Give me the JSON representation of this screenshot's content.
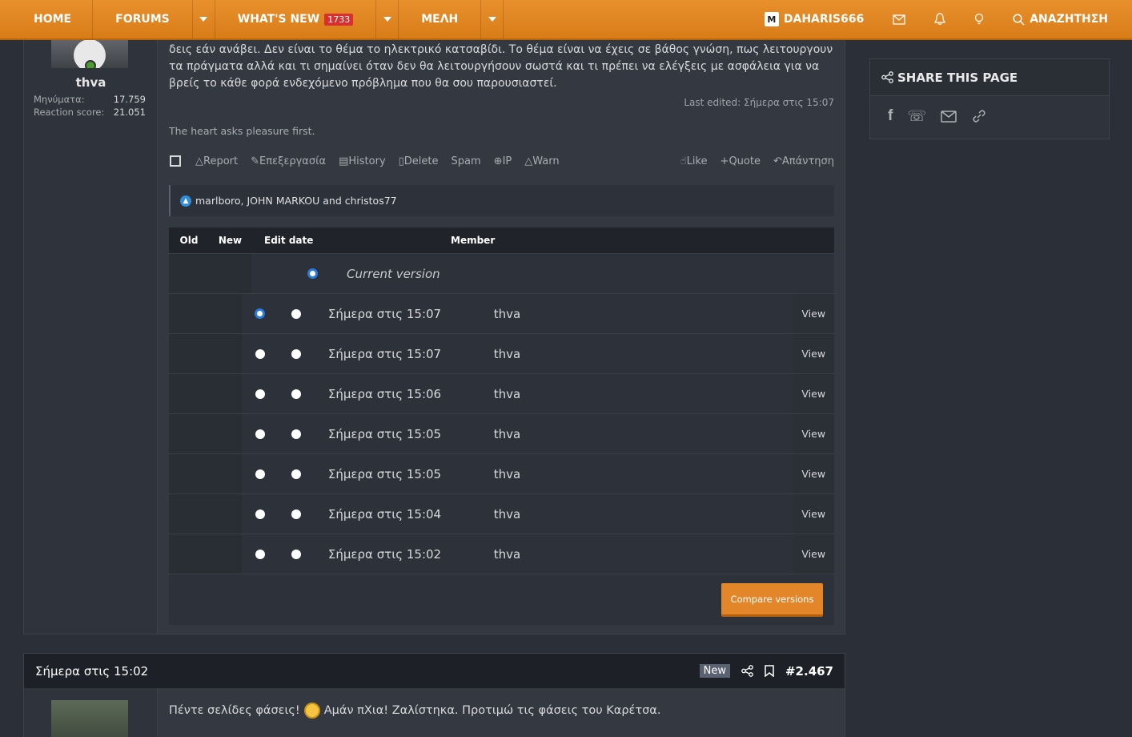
{
  "nav": {
    "home": "HOME",
    "forums": "FORUMS",
    "whats_new": "WHAT'S NEW",
    "whats_new_count": "1733",
    "members": "ΜΕΛΗ",
    "user": "DAHARIS666",
    "search": "ΑΝΑΖΗΤΗΣΗ"
  },
  "post": {
    "username": "thva",
    "stats": [
      {
        "label": "Μηνύματα:",
        "value": "17.759"
      },
      {
        "label": "Reaction score:",
        "value": "21.051"
      }
    ],
    "body": "δεις εάν ανάβει. Δεν είναι το θέμα το ηλεκτρικό κατσαβίδι. Το θέμα είναι να έχεις σε βάθος γνώση, πως λειτουργουν τα πράγματα αλλά και τι σημαίνει όταν δεν θα λειτουργήσουν σωστά και τι πρέπει να ελέγξεις με ασφάλεια για να βρείς το κάθε φορά ενδεχόμενο πρόβλημα που θα σου παρουσιαστεί.",
    "last_edited": "Last edited: Σήμερα στις 15:07",
    "signature": "The heart asks pleasure first.",
    "actions": {
      "report": "Report",
      "edit": "Επεξεργασία",
      "history": "History",
      "delete": "Delete",
      "spam": "Spam",
      "ip": "IP",
      "warn": "Warn",
      "like": "Like",
      "quote": "Quote",
      "reply": "Απάντηση"
    },
    "likes": "marlboro, JOHN MARKOU and christos77"
  },
  "history": {
    "headers": {
      "old": "Old",
      "new": "New",
      "edit_date": "Edit date",
      "member": "Member"
    },
    "current_version": "Current version",
    "view_label": "View",
    "rows": [
      {
        "date": "Σήμερα στις 15:07",
        "member": "thva"
      },
      {
        "date": "Σήμερα στις 15:07",
        "member": "thva"
      },
      {
        "date": "Σήμερα στις 15:06",
        "member": "thva"
      },
      {
        "date": "Σήμερα στις 15:05",
        "member": "thva"
      },
      {
        "date": "Σήμερα στις 15:05",
        "member": "thva"
      },
      {
        "date": "Σήμερα στις 15:04",
        "member": "thva"
      },
      {
        "date": "Σήμερα στις 15:02",
        "member": "thva"
      }
    ],
    "compare": "Compare versions"
  },
  "share": {
    "title": "SHARE THIS PAGE"
  },
  "post2": {
    "date": "Σήμερα στις 15:02",
    "new_tag": "New",
    "number": "#2.467",
    "text_before": "Πέντε σελίδες φάσεις!",
    "text_after": "Αμάν πΧια! Ζαλίστηκα. Προτιμώ τις φάσεις του Καρέτσα."
  }
}
